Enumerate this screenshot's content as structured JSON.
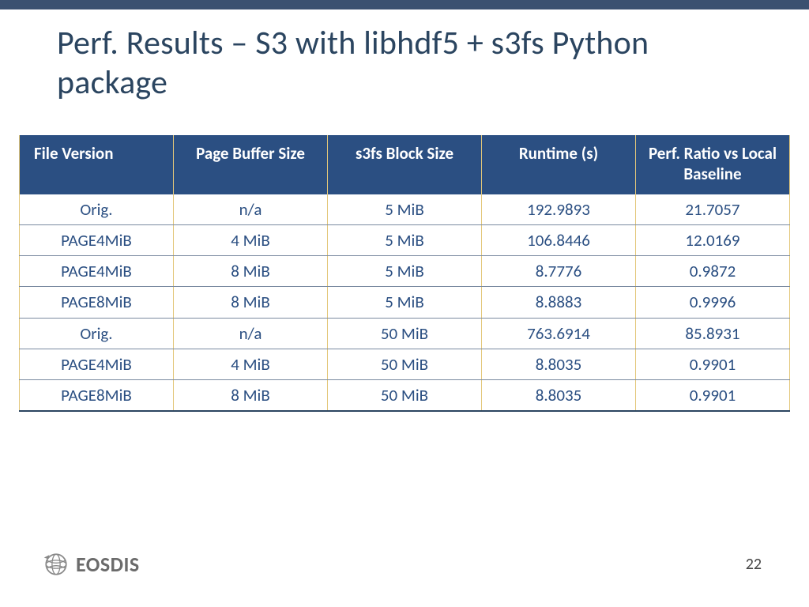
{
  "title": "Perf. Results – S3 with libhdf5 + s3fs Python package",
  "chart_data": {
    "type": "table",
    "columns": [
      "File Version",
      "Page Buffer Size",
      "s3fs Block Size",
      "Runtime (s)",
      "Perf. Ratio vs Local Baseline"
    ],
    "rows": [
      [
        "Orig.",
        "n/a",
        "5 MiB",
        "192.9893",
        "21.7057"
      ],
      [
        "PAGE4MiB",
        "4 MiB",
        "5 MiB",
        "106.8446",
        "12.0169"
      ],
      [
        "PAGE4MiB",
        "8 MiB",
        "5 MiB",
        "8.7776",
        "0.9872"
      ],
      [
        "PAGE8MiB",
        "8 MiB",
        "5 MiB",
        "8.8883",
        "0.9996"
      ],
      [
        "Orig.",
        "n/a",
        "50 MiB",
        "763.6914",
        "85.8931"
      ],
      [
        "PAGE4MiB",
        "4 MiB",
        "50 MiB",
        "8.8035",
        "0.9901"
      ],
      [
        "PAGE8MiB",
        "8 MiB",
        "50 MiB",
        "8.8035",
        "0.9901"
      ]
    ]
  },
  "footer": {
    "logo": "EOSDIS",
    "page": "22"
  }
}
